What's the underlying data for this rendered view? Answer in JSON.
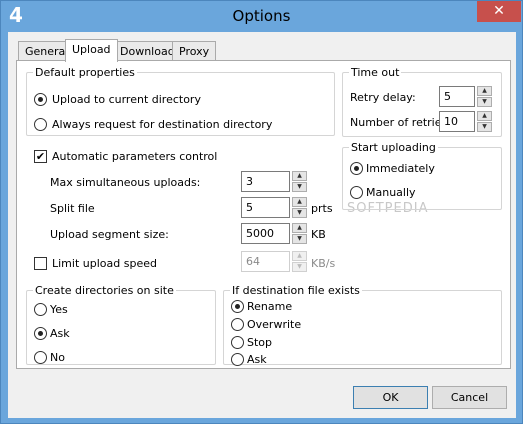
{
  "window": {
    "title": "Options",
    "close_glyph": "✕",
    "app_icon_glyph": "4"
  },
  "tabs": [
    {
      "label": "General",
      "active": false
    },
    {
      "label": "Upload",
      "active": true
    },
    {
      "label": "Download",
      "active": false
    },
    {
      "label": "Proxy",
      "active": false
    }
  ],
  "default_properties": {
    "legend": "Default properties",
    "options": [
      {
        "label": "Upload to current directory",
        "selected": true
      },
      {
        "label": "Always request for destination directory",
        "selected": false
      }
    ]
  },
  "timeout": {
    "legend": "Time out",
    "retry_delay_label": "Retry delay:",
    "retry_delay_value": "5",
    "retries_label": "Number of retries:",
    "retries_value": "10"
  },
  "start_uploading": {
    "legend": "Start uploading",
    "options": [
      {
        "label": "Immediately",
        "selected": true
      },
      {
        "label": "Manually",
        "selected": false
      }
    ]
  },
  "auto_params": {
    "label": "Automatic parameters control",
    "checked": true,
    "check_glyph": "✔",
    "max_uploads_label": "Max simultaneous uploads:",
    "max_uploads_value": "3",
    "split_file_label": "Split file",
    "split_file_value": "5",
    "split_file_unit": "prts",
    "segment_label": "Upload segment size:",
    "segment_value": "5000",
    "segment_unit": "KB"
  },
  "limit_speed": {
    "label": "Limit upload speed",
    "checked": false,
    "value": "64",
    "unit": "KB/s"
  },
  "create_dirs": {
    "legend": "Create directories on site",
    "options": [
      {
        "label": "Yes",
        "selected": false
      },
      {
        "label": "Ask",
        "selected": true
      },
      {
        "label": "No",
        "selected": false
      }
    ]
  },
  "dest_exists": {
    "legend": "If destination file exists",
    "options": [
      {
        "label": "Rename",
        "selected": true
      },
      {
        "label": "Overwrite",
        "selected": false
      },
      {
        "label": "Stop",
        "selected": false
      },
      {
        "label": "Ask",
        "selected": false
      }
    ]
  },
  "buttons": {
    "ok": "OK",
    "cancel": "Cancel"
  },
  "spin_glyphs": {
    "up": "▲",
    "down": "▼"
  },
  "watermark": "SOFTPEDIA"
}
